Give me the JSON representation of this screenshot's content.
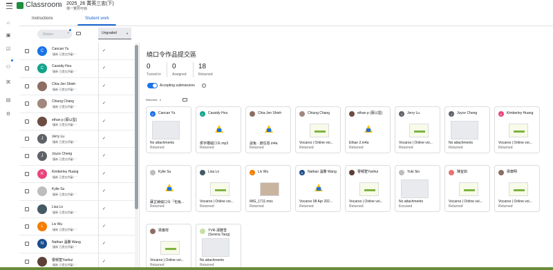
{
  "header": {
    "app_title": "Classroom",
    "class_name": "2025_26 菁英三忠(下)",
    "class_section": "傳一覽附可冊"
  },
  "tabs": [
    {
      "label": "Instructions",
      "active": false
    },
    {
      "label": "Student work",
      "active": true
    }
  ],
  "toolbar": {
    "return_label": "Return",
    "grade_filter": "Ungraded"
  },
  "students": [
    {
      "name": "Cancan Yu",
      "status": "\"圖新 已提交評審！\"",
      "initial": "C",
      "color": "#1a73e8",
      "checked": true
    },
    {
      "name": "Cassidy Hou",
      "status": "\"圖新 已提交評審！\"",
      "initial": "C",
      "color": "#12a38a",
      "checked": true
    },
    {
      "name": "Chia-Jen Shieh",
      "status": "\"圖新 已提交評審！\"",
      "initial": "",
      "color": "#8d6e63",
      "checked": true
    },
    {
      "name": "Chiung Chang",
      "status": "\"圖新 已提交評審！\"",
      "initial": "",
      "color": "#a1887f",
      "checked": true
    },
    {
      "name": "ethan p (蔡以堅)",
      "status": "\"圖新 已提交評審！\"",
      "initial": "",
      "color": "#6d4c41",
      "checked": true
    },
    {
      "name": "Jerry Lu",
      "status": "\"圖新 已提交評審！\"",
      "initial": "J",
      "color": "#5f6368",
      "checked": true
    },
    {
      "name": "Joyce Cheng",
      "status": "\"圖新 已提交評審！\"",
      "initial": "J",
      "color": "#5f6368",
      "checked": true
    },
    {
      "name": "Kimberley Huang",
      "status": "\"圖新 已提交評審！\"",
      "initial": "K",
      "color": "#e8457a",
      "checked": true
    },
    {
      "name": "Kylie Su",
      "status": "\"圖新 已提交評審！\"",
      "initial": "",
      "color": "#bdbdbd",
      "checked": true
    },
    {
      "name": "Lisa Lo",
      "status": "\"圖新 已提交評審！\"",
      "initial": "",
      "color": "#455a64",
      "checked": true
    },
    {
      "name": "Liv Wu",
      "status": "\"圖新 已提交評審！\"",
      "initial": "L",
      "color": "#f57c00",
      "checked": true
    },
    {
      "name": "Nathan 溫縢 Wang",
      "status": "\"圖新 已提交評審！\"",
      "initial": "N",
      "color": "#1a4d8c",
      "checked": true
    },
    {
      "name": "曹郁萱Yanhui",
      "status": "\"圖新 已提交評審！\"",
      "initial": "",
      "color": "#5d4037",
      "checked": true
    }
  ],
  "assignment": {
    "title": "繞口令作品提交區",
    "turned_in": "0",
    "turned_in_label": "Turned in",
    "assigned": "0",
    "assigned_label": "Assigned",
    "returned": "18",
    "returned_label": "Returned",
    "accepting_label": "Accepting submissions",
    "filter_label": "Returned"
  },
  "cards": [
    {
      "name": "Cancan Yu",
      "file": "No attachments",
      "status": "Returned",
      "thumb": "blank",
      "color": "#1a73e8",
      "initial": "C"
    },
    {
      "name": "Cassidy Hou",
      "file": "侯宇橋繞口令.mp3",
      "status": "Returned",
      "thumb": "drive",
      "color": "#12a38a",
      "initial": "C"
    },
    {
      "name": "Chia-Jen Shieh",
      "file": "說兔 · 謝任恩.m4a",
      "status": "Returned",
      "thumb": "drive",
      "color": "#8d6e63",
      "initial": ""
    },
    {
      "name": "Chiung Chang",
      "file": "Vocaroo | Online voi...",
      "status": "Returned",
      "thumb": "vocaroo",
      "color": "#a1887f",
      "initial": ""
    },
    {
      "name": "ethan p (蔡以堅)",
      "file": "Ethan 2.m4a",
      "status": "Returned",
      "thumb": "drive",
      "color": "#6d4c41",
      "initial": ""
    },
    {
      "name": "Jerry Lu",
      "file": "Vocaroo | Online voi...",
      "status": "Returned",
      "thumb": "vocaroo",
      "color": "#5f6368",
      "initial": "J"
    },
    {
      "name": "Joyce Cheng",
      "file": "No attachments",
      "status": "Returned",
      "thumb": "blank",
      "color": "#5f6368",
      "initial": "J"
    },
    {
      "name": "Kimberley Huang",
      "file": "Vocaroo | Online voi...",
      "status": "Returned",
      "thumb": "vocaroo",
      "color": "#e8457a",
      "initial": "K"
    },
    {
      "name": "Kylie Su",
      "file": "蘇芷綾繞口令「包兔...",
      "status": "Returned",
      "thumb": "drive",
      "color": "#bdbdbd",
      "initial": ""
    },
    {
      "name": "Lisa Lo",
      "file": "Vocaroo | Online voi...",
      "status": "Returned",
      "thumb": "vocaroo",
      "color": "#455a64",
      "initial": ""
    },
    {
      "name": "Liv Wu",
      "file": "IMG_1711.mov",
      "status": "Returned",
      "thumb": "photo",
      "color": "#f57c00",
      "initial": "L"
    },
    {
      "name": "Nathan 溫縢 Wang",
      "file": "Vocaroo 08 Apr 202...",
      "status": "Returned",
      "thumb": "drive",
      "color": "#1a4d8c",
      "initial": "N"
    },
    {
      "name": "曹郁萱Yanhui",
      "file": "Vocaroo | Online voi...",
      "status": "Returned",
      "thumb": "vocaroo",
      "color": "#5d4037",
      "initial": ""
    },
    {
      "name": "Yuki Sio",
      "file": "No attachments",
      "status": "Excused",
      "thumb": "blank",
      "color": "#bdbdbd",
      "initial": ""
    },
    {
      "name": "陳宜如",
      "file": "Vocaroo | Online voi...",
      "status": "Returned",
      "thumb": "vocaroo",
      "color": "#e57373",
      "initial": ""
    },
    {
      "name": "梁庸明",
      "file": "Vocaroo | Online voi...",
      "status": "Returned",
      "thumb": "vocaroo",
      "color": "#8d6e63",
      "initial": ""
    },
    {
      "name": "梁庸祥",
      "file": "Vocaroo | Online voi...",
      "status": "Returned",
      "thumb": "vocaroo",
      "color": "#8d6e63",
      "initial": ""
    },
    {
      "name": "YVR-湯雅雪 (Serena Tang)",
      "file": "No attachments",
      "status": "Returned",
      "thumb": "blank",
      "color": "#c5e1a5",
      "initial": ""
    }
  ]
}
